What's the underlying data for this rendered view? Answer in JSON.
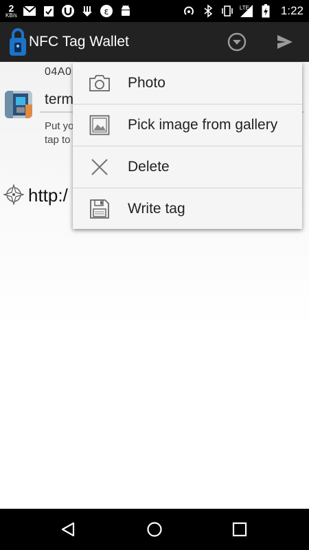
{
  "status_bar": {
    "net_speed": "2",
    "net_unit": "KB/s",
    "network": "LTE",
    "time": "1:22",
    "notification_icons": [
      "speed-icon",
      "gmail-icon",
      "clipboard-icon",
      "utorrent-icon",
      "download-icon",
      "euro-icon",
      "android-icon"
    ],
    "system_icons": [
      "hotspot-icon",
      "bluetooth-icon",
      "vibrate-icon",
      "signal-icon",
      "battery-icon"
    ]
  },
  "action_bar": {
    "title": "NFC Tag Wallet",
    "app_icon": "nfc-lock-icon",
    "buttons": [
      "dropdown-circle-icon",
      "send-icon"
    ]
  },
  "content": {
    "uid": "04A0",
    "term_value": "term",
    "description_line1": "Put yo",
    "description_line2": "tap to",
    "link_text": "http:/"
  },
  "popup_menu": {
    "items": [
      {
        "label": "Photo",
        "icon": "camera-icon"
      },
      {
        "label": "Pick image from gallery",
        "icon": "gallery-icon"
      },
      {
        "label": "Delete",
        "icon": "delete-x-icon"
      },
      {
        "label": "Write tag",
        "icon": "floppy-disk-icon"
      }
    ]
  },
  "nav_bar": {
    "buttons": [
      "back-icon",
      "home-icon",
      "recents-icon"
    ]
  },
  "colors": {
    "status_bar": "#000000",
    "action_bar": "#222222",
    "popup_bg": "#f5f5f5",
    "app_icon_blue": "#1e73c8"
  }
}
